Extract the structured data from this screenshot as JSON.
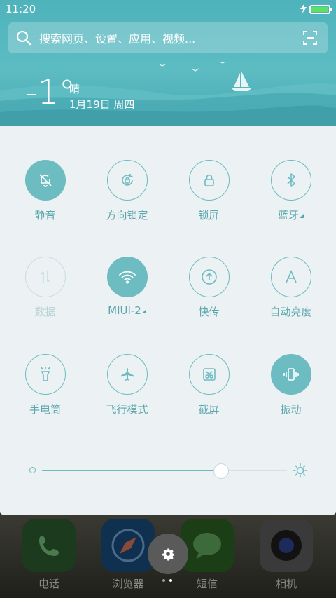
{
  "status_bar": {
    "time": "11:20",
    "battery_level": 1.0
  },
  "search": {
    "placeholder": "搜索网页、设置、应用、视频..."
  },
  "weather": {
    "temperature": "-1°",
    "condition": "晴",
    "date": "1月19日 周四"
  },
  "toggles": [
    {
      "id": "mute",
      "label": "静音",
      "icon": "bell-off-icon",
      "state": "on"
    },
    {
      "id": "rotation-lock",
      "label": "方向锁定",
      "icon": "rotation-lock-icon",
      "state": "off"
    },
    {
      "id": "lock-screen",
      "label": "锁屏",
      "icon": "lock-icon",
      "state": "off"
    },
    {
      "id": "bluetooth",
      "label": "蓝牙",
      "icon": "bluetooth-icon",
      "state": "off",
      "has_more": true
    },
    {
      "id": "data",
      "label": "数据",
      "icon": "data-arrows-icon",
      "state": "disabled"
    },
    {
      "id": "wifi",
      "label": "MIUI-2",
      "icon": "wifi-icon",
      "state": "on",
      "has_more": true
    },
    {
      "id": "quick-transfer",
      "label": "快传",
      "icon": "upload-circle-icon",
      "state": "off"
    },
    {
      "id": "auto-brightness",
      "label": "自动亮度",
      "icon": "letter-a-icon",
      "state": "off"
    },
    {
      "id": "flashlight",
      "label": "手电筒",
      "icon": "flashlight-icon",
      "state": "off"
    },
    {
      "id": "airplane",
      "label": "飞行模式",
      "icon": "airplane-icon",
      "state": "off"
    },
    {
      "id": "screenshot",
      "label": "截屏",
      "icon": "scissors-icon",
      "state": "off"
    },
    {
      "id": "vibrate",
      "label": "振动",
      "icon": "vibrate-icon",
      "state": "on"
    }
  ],
  "brightness": {
    "level": 0.73
  },
  "dock": [
    {
      "label": "电话",
      "icon": "phone-icon"
    },
    {
      "label": "浏览器",
      "icon": "compass-icon"
    },
    {
      "label": "短信",
      "icon": "chat-bubble-icon"
    },
    {
      "label": "相机",
      "icon": "camera-icon"
    }
  ],
  "page_indicator": {
    "count": 2,
    "active": 1
  },
  "colors": {
    "accent": "#6dbcc2",
    "header": "#4fb3bc",
    "panel": "#ecf1f3"
  }
}
